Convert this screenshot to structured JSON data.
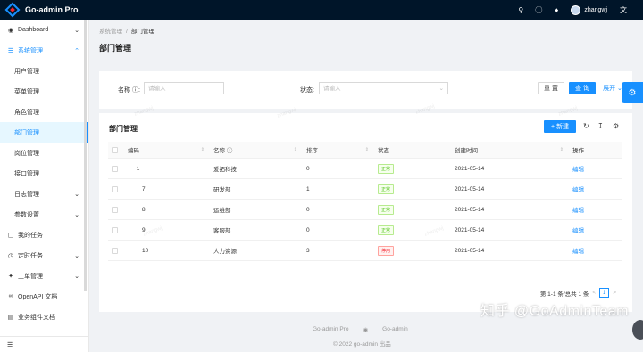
{
  "app": {
    "title": "Go-admin Pro"
  },
  "topbar": {
    "icons": [
      "search-icon",
      "question-icon",
      "bell-icon",
      "translate-icon"
    ],
    "username": "zhangwj"
  },
  "sidebar": {
    "items": [
      {
        "label": "Dashboard",
        "icon": "dashboard-icon",
        "arrow": "⌄"
      },
      {
        "label": "系统管理",
        "icon": "system-icon",
        "arrow": "⌃"
      },
      {
        "label": "日志管理",
        "icon": "",
        "arrow": "⌄"
      },
      {
        "label": "参数设置",
        "icon": "",
        "arrow": "⌄"
      },
      {
        "label": "我的任务",
        "icon": "task-icon",
        "arrow": ""
      },
      {
        "label": "定时任务",
        "icon": "clock-icon",
        "arrow": "⌄"
      },
      {
        "label": "工单管理",
        "icon": "ticket-icon",
        "arrow": "⌄"
      },
      {
        "label": "OpenAPI 文档",
        "icon": "link-icon",
        "arrow": ""
      },
      {
        "label": "业务组件文档",
        "icon": "doc-icon",
        "arrow": ""
      }
    ],
    "sub_items": [
      {
        "label": "用户管理"
      },
      {
        "label": "菜单管理"
      },
      {
        "label": "角色管理"
      },
      {
        "label": "部门管理"
      },
      {
        "label": "岗位管理"
      },
      {
        "label": "接口管理"
      }
    ]
  },
  "breadcrumb": {
    "parent": "系统管理",
    "separator": "/",
    "current": "部门管理"
  },
  "page": {
    "title": "部门管理"
  },
  "search": {
    "name_label": "名称",
    "name_placeholder": "请输入",
    "status_label": "状态:",
    "status_placeholder": "请输入",
    "reset_label": "重 置",
    "query_label": "查 询",
    "expand_label": "展开"
  },
  "table": {
    "title": "部门管理",
    "new_label": "+ 新建",
    "columns": {
      "code": "编码",
      "name": "名称",
      "order": "排序",
      "status": "状态",
      "created": "创建时间",
      "op": "操作"
    },
    "rows": [
      {
        "code": "1",
        "expander": "−",
        "name": "爱拓科技",
        "order": "0",
        "status": "正常",
        "status_type": "ok",
        "created": "2021-05-14",
        "op": "编辑"
      },
      {
        "code": "7",
        "expander": "",
        "name": "研发部",
        "order": "1",
        "status": "正常",
        "status_type": "ok",
        "created": "2021-05-14",
        "op": "编辑"
      },
      {
        "code": "8",
        "expander": "",
        "name": "运维部",
        "order": "0",
        "status": "正常",
        "status_type": "ok",
        "created": "2021-05-14",
        "op": "编辑"
      },
      {
        "code": "9",
        "expander": "",
        "name": "客服部",
        "order": "0",
        "status": "正常",
        "status_type": "ok",
        "created": "2021-05-14",
        "op": "编辑"
      },
      {
        "code": "10",
        "expander": "",
        "name": "人力资源",
        "order": "3",
        "status": "停用",
        "status_type": "off",
        "created": "2021-05-14",
        "op": "编辑"
      }
    ],
    "pagination": {
      "summary": "第 1-1 条/总共 1 条",
      "prev": "<",
      "current": "1",
      "next": ">"
    }
  },
  "footer": {
    "link1": "Go-admin Pro",
    "link2": "Go-admin",
    "copyright": "© 2022 go-admin 出品"
  },
  "watermark": {
    "brand": "知乎 @GoAdminTeam",
    "user": "zhangwj"
  },
  "colors": {
    "primary": "#1890ff",
    "header": "#001529",
    "success": "#52c41a",
    "danger": "#f5222d"
  }
}
